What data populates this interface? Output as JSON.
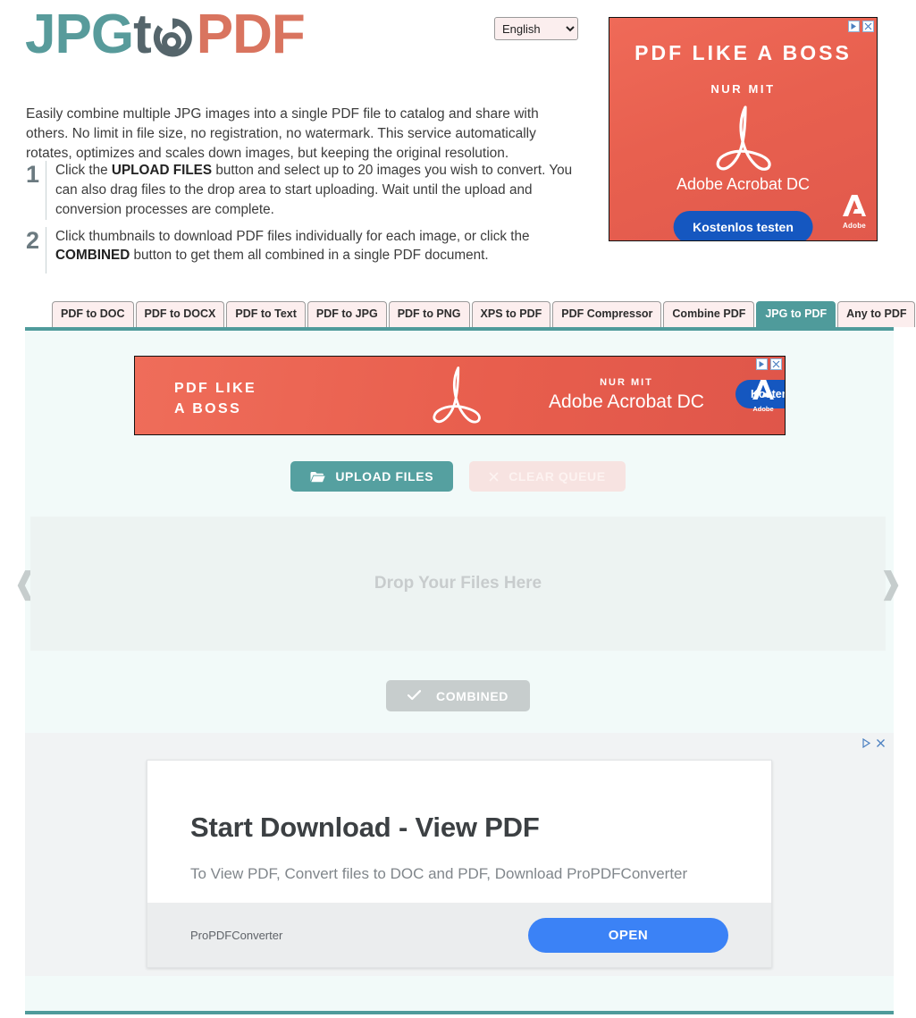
{
  "header": {
    "logo": {
      "part1": "JPG",
      "part2": "t",
      "part3": "PDF",
      "icon": "circular-arrow-icon"
    },
    "language": {
      "selected": "English",
      "options": [
        "English"
      ]
    },
    "intro": "Easily combine multiple JPG images into a single PDF file to catalog and share with others. No limit in file size, no registration, no watermark. This service automatically rotates, optimizes and scales down images, but keeping the original resolution.",
    "steps": [
      {
        "number": "1",
        "text_before": "Click the ",
        "bold1": "UPLOAD FILES",
        "text_after": " button and select up to 20 images you wish to convert. You can also drag files to the drop area to start uploading. Wait until the upload and conversion processes are complete."
      },
      {
        "number": "2",
        "text_before": "Click thumbnails to download PDF files individually for each image, or click the ",
        "bold1": "COMBINED",
        "text_after": " button to get them all combined in a single PDF document."
      }
    ]
  },
  "tabs": [
    {
      "label": "PDF to DOC",
      "active": false
    },
    {
      "label": "PDF to DOCX",
      "active": false
    },
    {
      "label": "PDF to Text",
      "active": false
    },
    {
      "label": "PDF to JPG",
      "active": false
    },
    {
      "label": "PDF to PNG",
      "active": false
    },
    {
      "label": "XPS to PDF",
      "active": false
    },
    {
      "label": "PDF Compressor",
      "active": false
    },
    {
      "label": "Combine PDF",
      "active": false
    },
    {
      "label": "JPG to PDF",
      "active": true
    },
    {
      "label": "Any to PDF",
      "active": false
    }
  ],
  "ad_square": {
    "title": "PDF LIKE A BOSS",
    "subtitle": "NUR MIT",
    "product": "Adobe Acrobat DC",
    "cta": "Kostenlos testen",
    "brand": "Adobe",
    "bg_color": "#e8604f",
    "cta_color": "#1557c0"
  },
  "ad_banner": {
    "title_line1": "PDF LIKE",
    "title_line2": "A BOSS",
    "subtitle": "NUR MIT",
    "product": "Adobe Acrobat DC",
    "cta": "Kostenlos testen",
    "brand": "Adobe",
    "bg_color": "#e85e4d",
    "cta_color": "#1557c0"
  },
  "main": {
    "upload_button": "UPLOAD FILES",
    "clear_button": "CLEAR QUEUE",
    "drop_text": "Drop Your Files Here",
    "combined_button": "COMBINED",
    "prev_arrow": "❰",
    "next_arrow": "❱",
    "accent_color": "#4f9b9b",
    "panel_bg": "#f2faf9"
  },
  "ad_bottom": {
    "headline": "Start Download - View PDF",
    "description": "To View PDF, Convert files to DOC and PDF, Download ProPDFConverter",
    "brand": "ProPDFConverter",
    "button": "OPEN",
    "button_color": "#3b82f6"
  },
  "adchoices": {
    "label": "AdChoices",
    "close": "✕"
  }
}
